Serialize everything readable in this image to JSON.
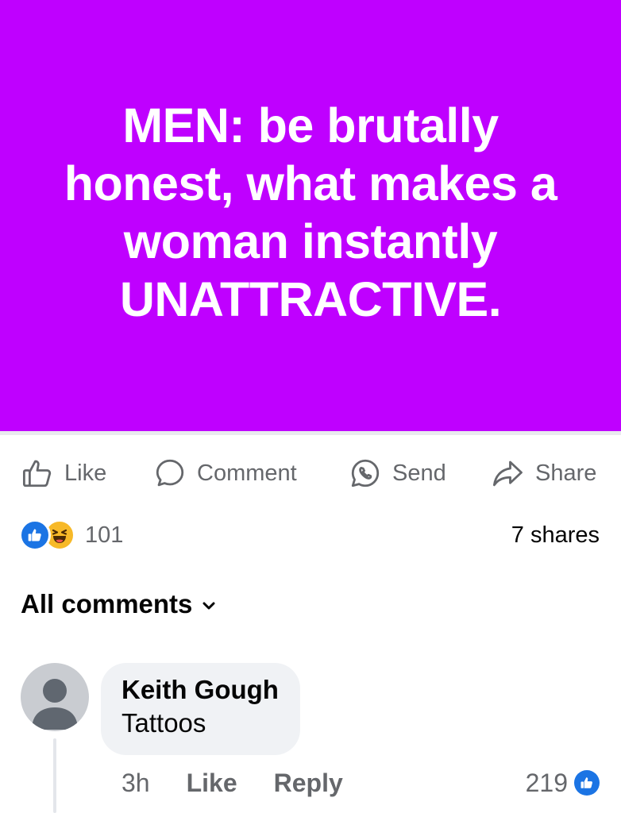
{
  "post": {
    "banner_text": "MEN: be brutally honest, what makes a woman instantly UNATTRACTIVE.",
    "banner_color": "#bf00ff"
  },
  "actions": {
    "like_label": "Like",
    "comment_label": "Comment",
    "send_label": "Send",
    "share_label": "Share"
  },
  "reactions": {
    "types": [
      "like-icon",
      "haha-icon"
    ],
    "count": "101"
  },
  "shares": {
    "label": "7 shares"
  },
  "comments_filter": {
    "label": "All comments"
  },
  "comments": [
    {
      "author": "Keith Gough",
      "text": "Tattoos",
      "time": "3h",
      "like_label": "Like",
      "reply_label": "Reply",
      "likes": "219"
    }
  ],
  "colors": {
    "accent": "#1b74e4",
    "muted_text": "#65676b",
    "bubble": "#f0f2f5"
  }
}
